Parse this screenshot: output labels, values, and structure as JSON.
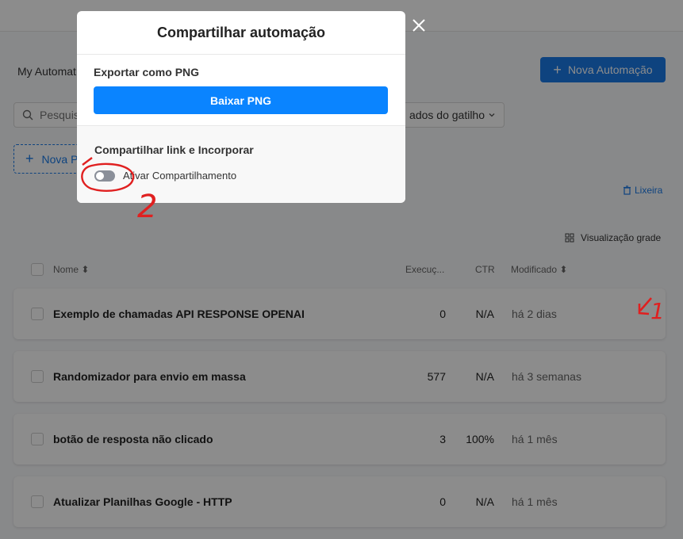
{
  "page": {
    "title": "My Automat",
    "new_automation_label": "Nova Automação",
    "search_placeholder": "Pesquis",
    "filter_label": "ados do gatilho",
    "new_folder_label": "Nova P",
    "trash_label": "Lixeira",
    "grid_view_label": "Visualização grade"
  },
  "table": {
    "headers": {
      "name": "Nome",
      "executions": "Execuç...",
      "ctr": "CTR",
      "modified": "Modificado"
    },
    "rows": [
      {
        "name": "Exemplo de chamadas API RESPONSE OPENAI",
        "executions": "0",
        "ctr": "N/A",
        "modified": "há 2 dias"
      },
      {
        "name": "Randomizador para envio em massa",
        "executions": "577",
        "ctr": "N/A",
        "modified": "há 3 semanas"
      },
      {
        "name": "botão de resposta não clicado",
        "executions": "3",
        "ctr": "100%",
        "modified": "há 1 mês"
      },
      {
        "name": "Atualizar Planilhas Google - HTTP",
        "executions": "0",
        "ctr": "N/A",
        "modified": "há 1 mês"
      }
    ]
  },
  "modal": {
    "title": "Compartilhar automação",
    "export_label": "Exportar como PNG",
    "download_button": "Baixar PNG",
    "share_label": "Compartilhar link e Incorporar",
    "toggle_label": "Ativar Compartilhamento",
    "toggle_on": false
  },
  "annotations": {
    "mark_1": "1",
    "mark_2": "2"
  },
  "colors": {
    "primary": "#1a7be8",
    "download": "#0a84ff",
    "annotation": "#e02020"
  }
}
